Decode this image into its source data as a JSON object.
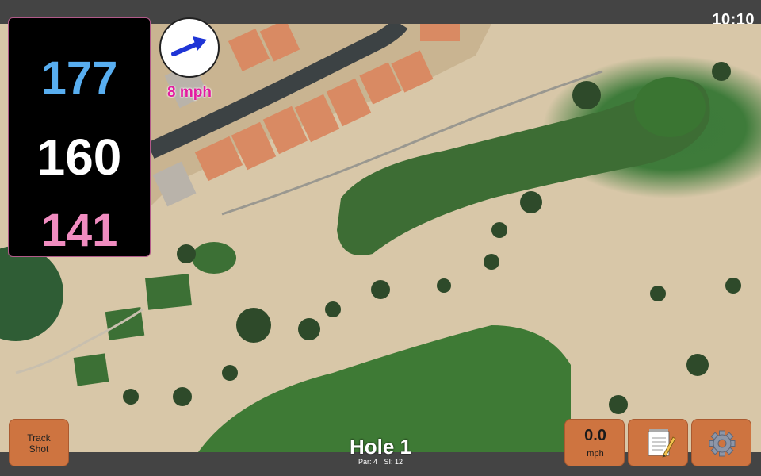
{
  "status": {
    "time": "10:10"
  },
  "distances": {
    "back": "177",
    "middle": "160",
    "front": "141"
  },
  "wind": {
    "speed": "8 mph",
    "arrow_icon": "wind-arrow-icon"
  },
  "hole": {
    "title": "Hole 1",
    "par": "Par: 4",
    "si": "SI: 12"
  },
  "buttons": {
    "track_shot_line1": "Track",
    "track_shot_line2": "Shot",
    "speed_value": "0.0",
    "speed_unit": "mph",
    "notes_icon": "notepad-icon",
    "settings_icon": "gear-icon"
  },
  "colors": {
    "back": "#58aef0",
    "middle": "#ffffff",
    "front": "#f08cc0",
    "wind_text": "#e31ca0",
    "button": "#ce7440"
  }
}
